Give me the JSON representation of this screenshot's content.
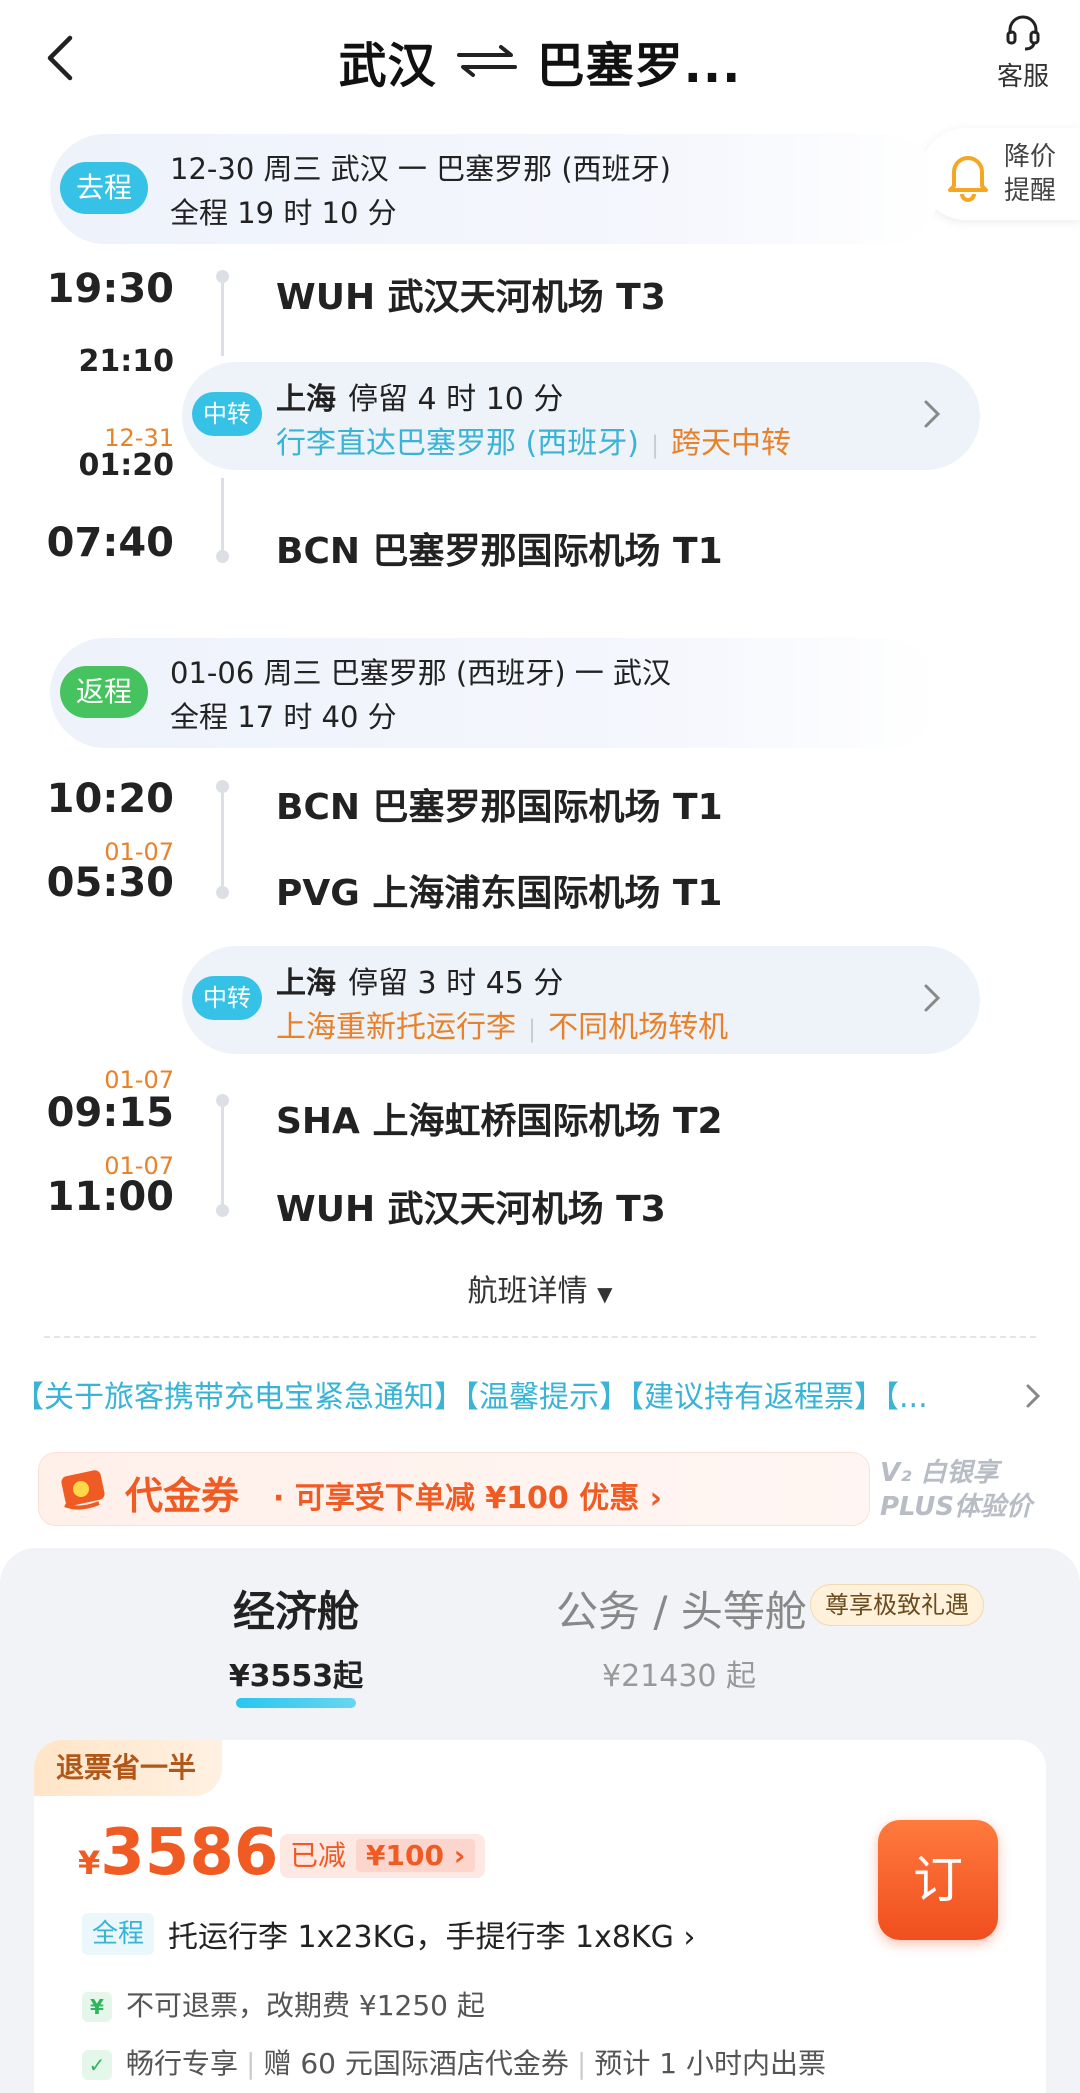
{
  "header": {
    "title_from": "武汉",
    "title_to": "巴塞罗...",
    "service_label": "客服"
  },
  "reminder": {
    "label": "降价提醒"
  },
  "outbound": {
    "badge": "去程",
    "line1": "12-30 周三   武汉 一 巴塞罗那 (西班牙)",
    "line2": "全程 19 时 10 分",
    "dep_time": "19:30",
    "dep_airport": "WUH 武汉天河机场 T3",
    "transfer_arr_time": "21:10",
    "transfer_dep_date": "12-31",
    "transfer_dep_time": "01:20",
    "transfer": {
      "badge": "中转",
      "city": "上海",
      "stay": "停留 4 时 10 分",
      "info1": "行李直达巴塞罗那 (西班牙)",
      "info2": "跨天中转"
    },
    "arr_time": "07:40",
    "arr_airport": "BCN 巴塞罗那国际机场 T1"
  },
  "return": {
    "badge": "返程",
    "line1": "01-06 周三   巴塞罗那 (西班牙) 一 武汉",
    "line2": "全程 17 时 40 分",
    "leg1_dep_time": "10:20",
    "leg1_dep_airport": "BCN 巴塞罗那国际机场 T1",
    "leg1_arr_date": "01-07",
    "leg1_arr_time": "05:30",
    "leg1_arr_airport": "PVG 上海浦东国际机场 T1",
    "transfer": {
      "badge": "中转",
      "city": "上海",
      "stay": "停留 3 时 45 分",
      "info1": "上海重新托运行李",
      "info2": "不同机场转机"
    },
    "leg2_dep_date": "01-07",
    "leg2_dep_time": "09:15",
    "leg2_dep_airport": "SHA 上海虹桥国际机场 T2",
    "leg2_arr_date": "01-07",
    "leg2_arr_time": "11:00",
    "leg2_arr_airport": "WUH 武汉天河机场 T3"
  },
  "flight_details": "航班详情",
  "notice": "【关于旅客携带充电宝紧急通知】【温馨提示】【建议持有返程票】【...",
  "voucher": {
    "title": "代金券",
    "text": "· 可享受下单减 ¥100 优惠  ›"
  },
  "plus": {
    "line1": "V₂ 白银享",
    "line2": "PLUS体验价"
  },
  "cabins": {
    "economy": {
      "name": "经济舱",
      "price": "¥3553起"
    },
    "business": {
      "name": "公务 / 头等舱",
      "price": "¥21430 起",
      "badge": "尊享极致礼遇"
    }
  },
  "offer": {
    "tag": "退票省一半",
    "currency": "¥",
    "price": "3586",
    "discount_label": "已减",
    "discount_amount": "¥100 ›",
    "book_label": "订",
    "bag_tag": "全程",
    "baggage": "托运行李 1x23KG，手提行李 1x8KG ›",
    "refund_rule": "不可退票，改期费 ¥1250 起",
    "perk1": "畅行专享",
    "perk2": "赠 60 元国际酒店代金券",
    "perk3": "预计 1 小时内出票"
  },
  "colors": {
    "outbound_badge": "#36c2e6",
    "return_badge": "#46c35f",
    "accent_orange": "#f05a23",
    "transfer_blue": "#39b3d6",
    "transfer_orange": "#e8822a"
  }
}
